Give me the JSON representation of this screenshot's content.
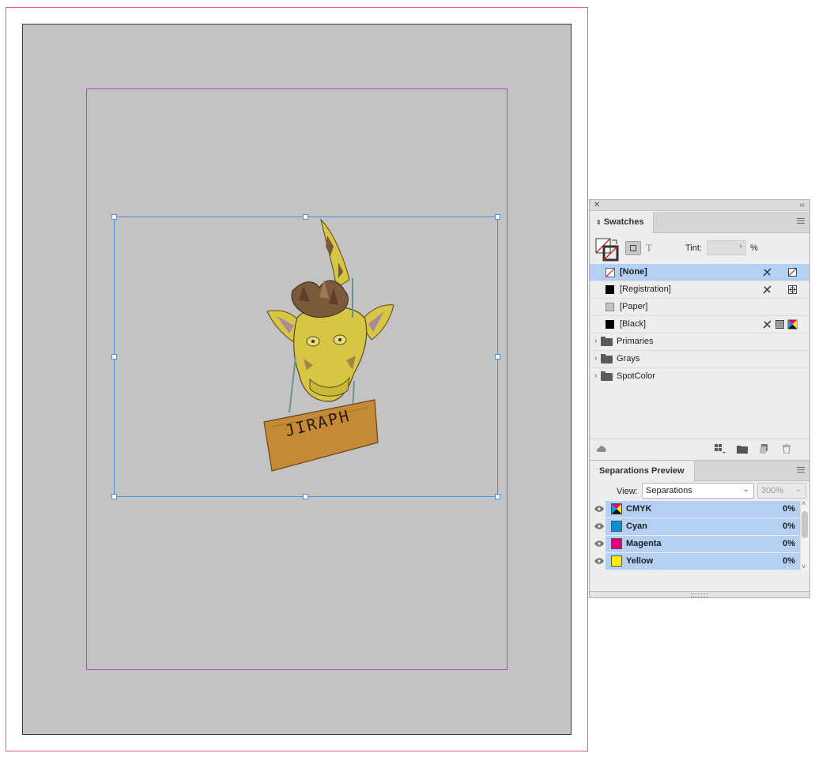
{
  "document": {
    "artwork_text": "JIRAPH"
  },
  "swatches_panel": {
    "tab_label": "Swatches",
    "tint_label": "Tint:",
    "tint_value": "",
    "tint_unit": "%",
    "swatches": [
      {
        "name": "[None]",
        "color": "none",
        "selected": true
      },
      {
        "name": "[Registration]",
        "color": "#000000",
        "selected": false
      },
      {
        "name": "[Paper]",
        "color": "#c3c3c3",
        "selected": false
      },
      {
        "name": "[Black]",
        "color": "#000000",
        "selected": false
      }
    ],
    "groups": [
      {
        "name": "Primaries"
      },
      {
        "name": "Grays"
      },
      {
        "name": "SpotColor"
      }
    ]
  },
  "separations_panel": {
    "tab_label": "Separations Preview",
    "view_label": "View:",
    "view_value": "Separations",
    "zoom_value": "300%",
    "plates": [
      {
        "name": "CMYK",
        "color": "cmyk",
        "value": "0%"
      },
      {
        "name": "Cyan",
        "color": "#0a8fd6",
        "value": "0%"
      },
      {
        "name": "Magenta",
        "color": "#e4007c",
        "value": "0%"
      },
      {
        "name": "Yellow",
        "color": "#ffee00",
        "value": "0%"
      }
    ]
  }
}
